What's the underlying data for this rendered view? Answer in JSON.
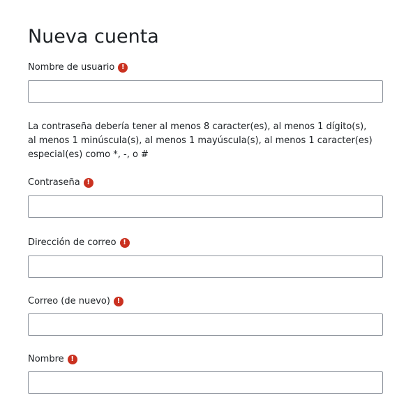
{
  "page": {
    "title": "Nueva cuenta"
  },
  "colors": {
    "required_icon": "#ca3120",
    "input_border": "#8f959e",
    "text": "#1d2125"
  },
  "form": {
    "username": {
      "label": "Nombre de usuario",
      "value": "",
      "required_icon": "exclamation-circle-icon"
    },
    "password_policy": "La contraseña debería tener al menos 8 caracter(es), al menos 1 dígito(s), al menos 1 minúscula(s), al menos 1 mayúscula(s), al menos 1 caracter(es) especial(es) como *, -, o #",
    "password": {
      "label": "Contraseña",
      "value": "",
      "required_icon": "exclamation-circle-icon"
    },
    "email": {
      "label": "Dirección de correo",
      "value": "",
      "required_icon": "exclamation-circle-icon"
    },
    "email_confirm": {
      "label": "Correo (de nuevo)",
      "value": "",
      "required_icon": "exclamation-circle-icon"
    },
    "first_name": {
      "label": "Nombre",
      "value": "",
      "required_icon": "exclamation-circle-icon"
    }
  }
}
